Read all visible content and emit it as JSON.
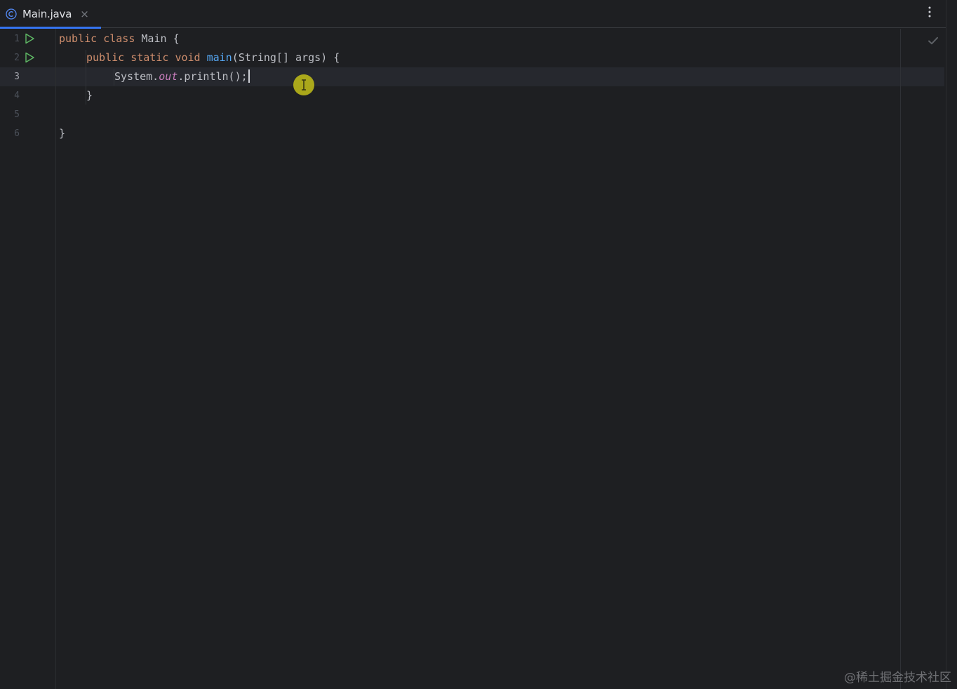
{
  "tab": {
    "label": "Main.java",
    "close_glyph": "×",
    "icon": "class-icon"
  },
  "toolbar": {
    "more_icon": "vertical-ellipsis-icon"
  },
  "editor": {
    "current_line": 3,
    "line_numbers": [
      "1",
      "2",
      "3",
      "4",
      "5",
      "6"
    ],
    "lines": [
      {
        "k1": "public",
        "k2": "class",
        "name": "Main",
        "brace": "{"
      },
      {
        "k1": "public",
        "k2": "static",
        "k3": "void",
        "fn": "main",
        "params": "(String[] args)",
        "brace": "{"
      },
      {
        "obj": "System.",
        "field": "out",
        "call": ".println();"
      },
      {
        "text": "}"
      },
      {
        "text": ""
      },
      {
        "text": "}"
      }
    ],
    "status_icon": "check-icon"
  },
  "colors": {
    "background": "#1e1f22",
    "keyword": "#cf8e6d",
    "function": "#56a8f5",
    "field": "#c77dbb",
    "accent": "#3574f0",
    "cursor_highlight": "#b6b31a"
  },
  "watermark": "@稀土掘金技术社区"
}
